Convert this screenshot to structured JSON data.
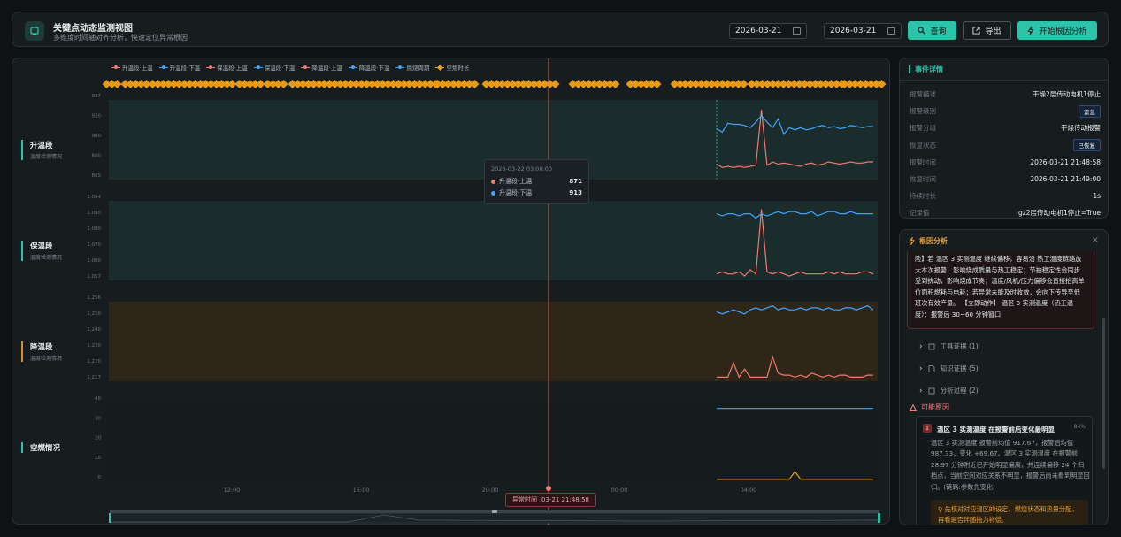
{
  "header": {
    "title": "关键点动态监测视图",
    "subtitle": "多维度时间轴对齐分析，快速定位异常根因",
    "date_from": "2026-03-21",
    "date_to": "2026-03-21",
    "date_sep": "→",
    "query_label": "查询",
    "export_label": "导出",
    "analyze_label": "开始根因分析"
  },
  "legend": [
    {
      "name": "升温段·上温",
      "color": "#f07a6e",
      "marker": "dot"
    },
    {
      "name": "升温段·下温",
      "color": "#3fa4ff",
      "marker": "dot"
    },
    {
      "name": "保温段·上温",
      "color": "#f07a6e",
      "marker": "dot"
    },
    {
      "name": "保温段·下温",
      "color": "#3fa4ff",
      "marker": "dot"
    },
    {
      "name": "降温段·上温",
      "color": "#f07a6e",
      "marker": "dot"
    },
    {
      "name": "降温段·下温",
      "color": "#3fa4ff",
      "marker": "dot"
    },
    {
      "name": "燃烧周期",
      "color": "#3fa4ff",
      "marker": "dot"
    },
    {
      "name": "空燃时长",
      "color": "#f0a020",
      "marker": "diamond"
    }
  ],
  "rows": [
    {
      "title": "升温段",
      "sub": "温度检测情况",
      "accent": "teal",
      "ticks": [
        "937",
        "920",
        "900",
        "880",
        "865"
      ],
      "ymin": 865,
      "ymax": 937
    },
    {
      "title": "保温段",
      "sub": "温度检测情况",
      "accent": "teal",
      "ticks": [
        "1,094",
        "1,090",
        "1,080",
        "1,070",
        "1,060",
        "1,057"
      ],
      "ymin": 1057,
      "ymax": 1094
    },
    {
      "title": "降温段",
      "sub": "温度检测情况",
      "accent": "orange",
      "ticks": [
        "1,256",
        "1,250",
        "1,240",
        "1,230",
        "1,220",
        "1,217"
      ],
      "ymin": 1217,
      "ymax": 1256
    },
    {
      "title": "空燃情况",
      "sub": "",
      "accent": "teal",
      "ticks": [
        "40",
        "30",
        "20",
        "10",
        "0"
      ],
      "ymin": 0,
      "ymax": 40
    }
  ],
  "xaxis": {
    "ticks": [
      "12:00",
      "16:00",
      "20:00",
      "00:00",
      "04:00"
    ]
  },
  "tooltip": {
    "time": "2026-03-22 03:00:00",
    "items": [
      {
        "name": "升温段·上温",
        "value": "871",
        "color": "#f07a6e"
      },
      {
        "name": "升温段·下温",
        "value": "913",
        "color": "#3fa4ff"
      }
    ]
  },
  "anomaly": {
    "label": "异常时间",
    "time": "03-21 21:48:58"
  },
  "event": {
    "title": "事件详情",
    "fields": [
      {
        "key": "报警描述",
        "value": "干燥2层传动电机1停止",
        "badge": false
      },
      {
        "key": "报警级别",
        "value": "紧急",
        "badge": true
      },
      {
        "key": "报警分组",
        "value": "干燥传动报警",
        "badge": false
      },
      {
        "key": "恢复状态",
        "value": "已恢复",
        "badge": true
      },
      {
        "key": "报警时间",
        "value": "2026-03-21 21:48:58",
        "badge": false
      },
      {
        "key": "恢复时间",
        "value": "2026-03-21 21:49:00",
        "badge": false
      },
      {
        "key": "持续时长",
        "value": "1s",
        "badge": false
      },
      {
        "key": "记录值",
        "value": "gz2层传动电机1停止=True",
        "badge": false
      }
    ]
  },
  "rca": {
    "title": "根因分析",
    "close": "×",
    "quote": "险】若 温区 3 实测温度 继续偏移，容易沿 热工温度链路放大本次报警，影响烧成质量与热工稳定；节拍稳定性会同步受到扰动，影响烧成节奏；温度/风机/压力偏移会直接抬高单位面积燃耗与电耗；若异常未能及时收敛，会向下传导至低班次有效产量。 【立即动作】 温区 3 实测温度（热工温度）：报警后 30~60 分钟窗口",
    "sections": [
      {
        "label": "工具证据 (1)"
      },
      {
        "label": "知识证据 (5)"
      },
      {
        "label": "分析过程 (2)"
      }
    ],
    "cause_head": "可能原因",
    "cause": {
      "num": "1",
      "title": "温区 3 实测温度 在报警前后变化最明显",
      "pct": "84%",
      "body": "温区 3 实测温度 报警前均值 917.67，报警后均值 987.33，变化 +69.67。温区 3 实测温度 在报警前 28.97 分钟附近已开始明显偏离，并连续偏移 24 个归档点，当前空间对应关系不明显，报警后尚未看到明显回归。(链路:参数先变化)",
      "advice": "先核对对应温区的设定、燃烧状态和热量分配，再看是否伴随抽力补偿。"
    }
  },
  "chart_data": [
    {
      "type": "line",
      "title": "升温段",
      "ylim": [
        865,
        937
      ],
      "series": [
        {
          "name": "升温段·上温",
          "values": [
            879,
            876,
            877,
            876,
            877,
            876,
            877,
            878,
            928,
            878,
            881,
            879,
            880,
            879,
            878,
            877,
            879,
            880,
            878,
            879,
            881,
            880,
            879,
            880,
            881,
            880,
            880,
            881,
            881
          ]
        },
        {
          "name": "升温段·下温",
          "values": [
            911,
            908,
            916,
            915,
            915,
            914,
            912,
            917,
            923,
            917,
            912,
            920,
            906,
            912,
            910,
            912,
            910,
            911,
            913,
            914,
            912,
            913,
            911,
            912,
            914,
            913,
            912,
            913,
            913
          ]
        }
      ]
    },
    {
      "type": "line",
      "title": "保温段",
      "ylim": [
        1057,
        1094
      ],
      "series": [
        {
          "name": "保温段·上温",
          "values": [
            1060,
            1061,
            1060,
            1060,
            1061,
            1059,
            1062,
            1060,
            1090,
            1061,
            1060,
            1061,
            1060,
            1059,
            1060,
            1061,
            1060,
            1060,
            1060,
            1060,
            1061,
            1060,
            1061,
            1060,
            1060,
            1060,
            1061,
            1061,
            1060
          ]
        },
        {
          "name": "保温段·下温",
          "values": [
            1088,
            1087,
            1088,
            1088,
            1087,
            1088,
            1088,
            1086,
            1088,
            1087,
            1088,
            1089,
            1088,
            1089,
            1089,
            1088,
            1088,
            1089,
            1087,
            1088,
            1089,
            1089,
            1088,
            1088,
            1089,
            1088,
            1088,
            1088,
            1088
          ]
        }
      ]
    },
    {
      "type": "line",
      "title": "降温段",
      "ylim": [
        1217,
        1256
      ],
      "series": [
        {
          "name": "降温段·上温",
          "values": [
            1219,
            1219,
            1219,
            1226,
            1219,
            1223,
            1219,
            1219,
            1219,
            1219,
            1229,
            1221,
            1220,
            1220,
            1219,
            1220,
            1219,
            1221,
            1220,
            1219,
            1220,
            1219,
            1220,
            1220,
            1219,
            1219,
            1219,
            1220,
            1220
          ]
        },
        {
          "name": "降温段·下温",
          "values": [
            1251,
            1250,
            1251,
            1252,
            1251,
            1250,
            1252,
            1253,
            1252,
            1253,
            1254,
            1252,
            1253,
            1252,
            1252,
            1253,
            1252,
            1253,
            1253,
            1252,
            1253,
            1252,
            1252,
            1253,
            1253,
            1252,
            1253,
            1254,
            1252
          ]
        }
      ]
    },
    {
      "type": "line",
      "title": "空燃情况",
      "ylim": [
        0,
        40
      ],
      "series": [
        {
          "name": "燃烧周期",
          "values": [
            37,
            37,
            37,
            37,
            37,
            37,
            37,
            37,
            37,
            37,
            37,
            37,
            37,
            37,
            37,
            37,
            37,
            37,
            37,
            37,
            37,
            37,
            37,
            37,
            37,
            37,
            37,
            37,
            37
          ]
        },
        {
          "name": "空燃时长",
          "values": [
            1,
            1,
            1,
            1,
            1,
            1,
            1,
            1,
            1,
            1,
            1,
            1,
            1,
            1,
            5,
            1,
            1,
            1,
            1,
            1,
            1,
            1,
            1,
            1,
            1,
            1,
            1,
            1,
            1
          ]
        }
      ]
    }
  ]
}
